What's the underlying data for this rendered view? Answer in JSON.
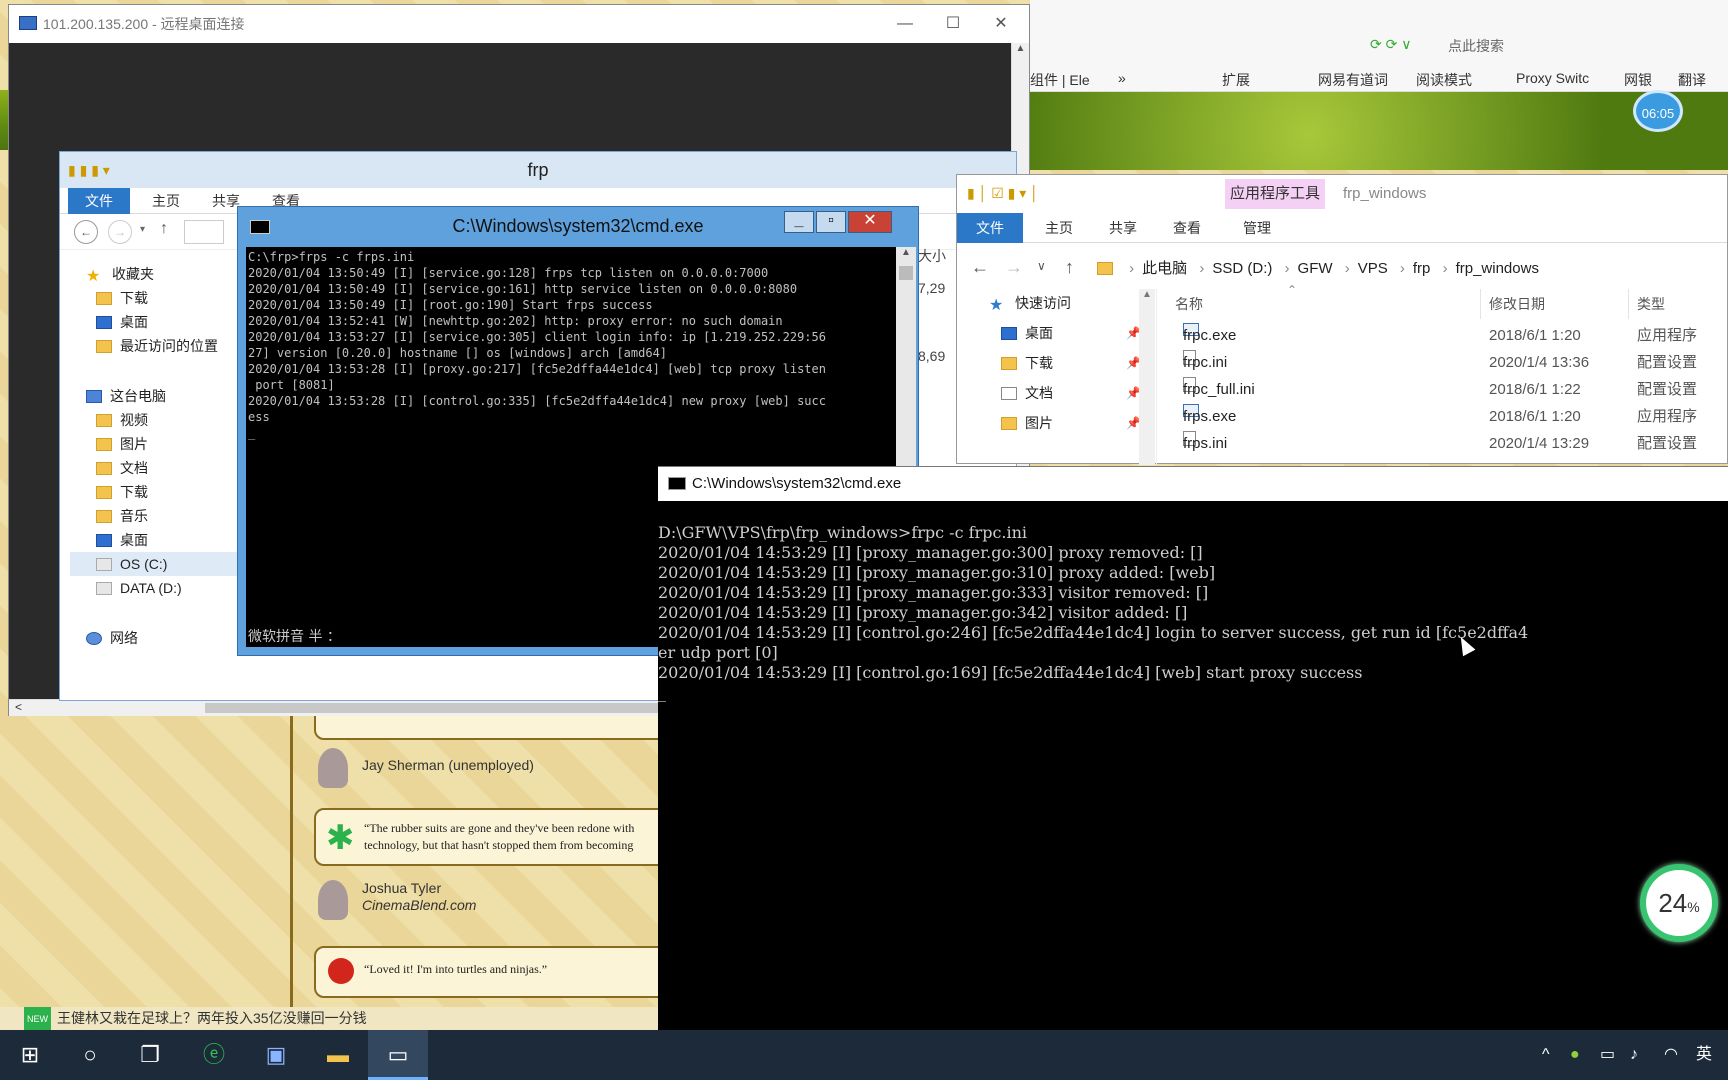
{
  "browser": {
    "search_placeholder": "点此搜索",
    "bookmarks": [
      "组件 | Ele",
      "»",
      "扩展",
      "网易有道词",
      "阅读模式",
      "Proxy Switc",
      "网银",
      "翻译"
    ],
    "clock": "06:05"
  },
  "bg_page": {
    "critic1": "Jay Sherman (unemployed)",
    "quote1": "“The rubber suits are gone and they've been redone with technology, but that hasn't stopped them from becoming",
    "critic2_name": "Joshua Tyler",
    "critic2_source": "CinemaBlend.com",
    "quote2": "“Loved it! I'm into turtles and ninjas.”",
    "ticker_badge": "NEW",
    "ticker": "王健林又栽在足球上？两年投入35亿没赚回一分钱"
  },
  "rdp": {
    "title": "101.200.135.200 - 远程桌面连接"
  },
  "frp_explorer": {
    "title": "frp",
    "tabs": [
      "文件",
      "主页",
      "共享",
      "查看"
    ],
    "tree": [
      {
        "label": "收藏夹",
        "icon": "star-icon"
      },
      {
        "label": "下载",
        "icon": "folder-icon"
      },
      {
        "label": "桌面",
        "icon": "folder-icon"
      },
      {
        "label": "最近访问的位置",
        "icon": "folder-icon"
      },
      {
        "label": "这台电脑",
        "icon": "pc-icon"
      },
      {
        "label": "视频",
        "icon": "folder-icon"
      },
      {
        "label": "图片",
        "icon": "folder-icon"
      },
      {
        "label": "文档",
        "icon": "folder-icon"
      },
      {
        "label": "下载",
        "icon": "folder-icon"
      },
      {
        "label": "音乐",
        "icon": "folder-icon"
      },
      {
        "label": "桌面",
        "icon": "folder-icon"
      },
      {
        "label": "OS (C:)",
        "icon": "drive-icon"
      },
      {
        "label": "DATA (D:)",
        "icon": "drive-icon"
      },
      {
        "label": "网络",
        "icon": "network-icon"
      }
    ],
    "right_fragments": [
      "大小",
      "7,29",
      "8,69"
    ]
  },
  "cmd_remote": {
    "title": "C:\\Windows\\system32\\cmd.exe",
    "output": "C:\\frp>frps -c frps.ini\n2020/01/04 13:50:49 [I] [service.go:128] frps tcp listen on 0.0.0.0:7000\n2020/01/04 13:50:49 [I] [service.go:161] http service listen on 0.0.0.0:8080\n2020/01/04 13:50:49 [I] [root.go:190] Start frps success\n2020/01/04 13:52:41 [W] [newhttp.go:202] http: proxy error: no such domain\n2020/01/04 13:53:27 [I] [service.go:305] client login info: ip [1.219.252.229:56\n27] version [0.20.0] hostname [] os [windows] arch [amd64]\n2020/01/04 13:53:28 [I] [proxy.go:217] [fc5e2dffa44e1dc4] [web] tcp proxy listen\n port [8081]\n2020/01/04 13:53:28 [I] [control.go:335] [fc5e2dffa44e1dc4] new proxy [web] succ\ness\n_",
    "ime": "微软拼音 半 ："
  },
  "local_explorer": {
    "title": "frp_windows",
    "tool_tab": "应用程序工具",
    "tabs": [
      "文件",
      "主页",
      "共享",
      "查看",
      "管理"
    ],
    "breadcrumb": [
      "此电脑",
      "SSD (D:)",
      "GFW",
      "VPS",
      "frp",
      "frp_windows"
    ],
    "quick_access": "快速访问",
    "tree": [
      {
        "label": "桌面",
        "icon": "folder-icon"
      },
      {
        "label": "下载",
        "icon": "download-folder-icon"
      },
      {
        "label": "文档",
        "icon": "document-folder-icon"
      },
      {
        "label": "图片",
        "icon": "picture-folder-icon"
      }
    ],
    "columns": [
      "名称",
      "修改日期",
      "类型"
    ],
    "files": [
      {
        "name": "frpc.exe",
        "date": "2018/6/1 1:20",
        "type": "应用程序",
        "kind": "exe"
      },
      {
        "name": "frpc.ini",
        "date": "2020/1/4 13:36",
        "type": "配置设置",
        "kind": "ini"
      },
      {
        "name": "frpc_full.ini",
        "date": "2018/6/1 1:22",
        "type": "配置设置",
        "kind": "ini"
      },
      {
        "name": "frps.exe",
        "date": "2018/6/1 1:20",
        "type": "应用程序",
        "kind": "exe"
      },
      {
        "name": "frps.ini",
        "date": "2020/1/4 13:29",
        "type": "配置设置",
        "kind": "ini"
      }
    ]
  },
  "cmd_local": {
    "title": "C:\\Windows\\system32\\cmd.exe",
    "output": "D:\\GFW\\VPS\\frp\\frp_windows>frpc -c frpc.ini\n2020/01/04 14:53:29 [I] [proxy_manager.go:300] proxy removed: []\n2020/01/04 14:53:29 [I] [proxy_manager.go:310] proxy added: [web]\n2020/01/04 14:53:29 [I] [proxy_manager.go:333] visitor removed: []\n2020/01/04 14:53:29 [I] [proxy_manager.go:342] visitor added: []\n2020/01/04 14:53:29 [I] [control.go:246] [fc5e2dffa44e1dc4] login to server success, get run id [fc5e2dffa4\ner udp port [0]\n2020/01/04 14:53:29 [I] [control.go:169] [fc5e2dffa44e1dc4] [web] start proxy success\n_"
  },
  "widget": {
    "value": "24",
    "unit": "%"
  },
  "taskbar": {
    "apps": [
      "start-icon",
      "cortana-icon",
      "task-view-icon",
      "ie-browser-icon",
      "remote-desktop-icon",
      "file-explorer-icon",
      "cmd-icon"
    ],
    "ime": "英"
  }
}
